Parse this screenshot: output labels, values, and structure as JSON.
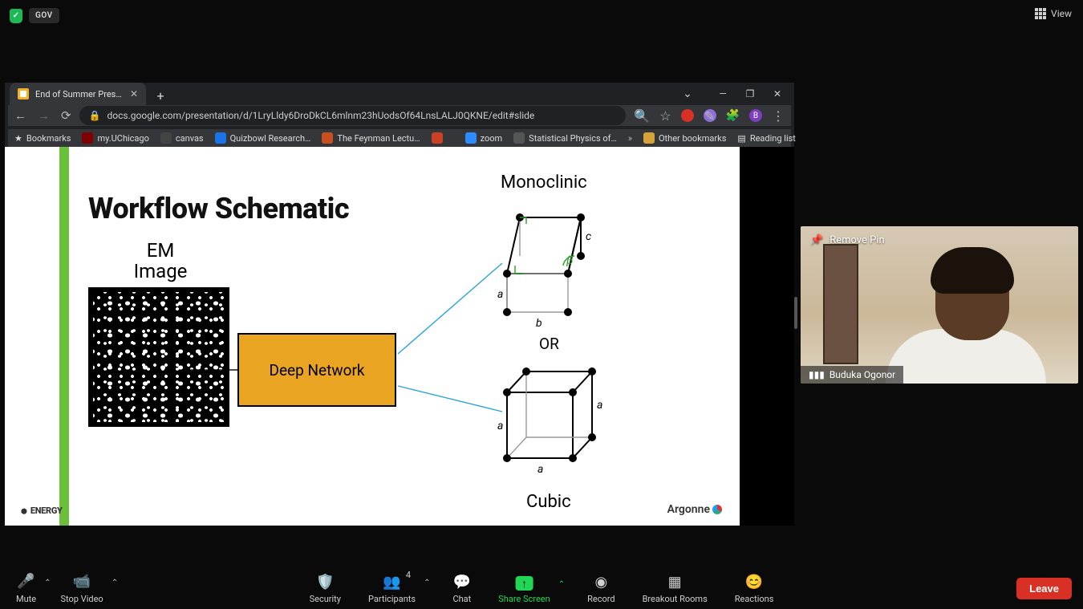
{
  "topbar": {
    "gov_label": "GOV",
    "view_label": "View"
  },
  "browser": {
    "tab_title": "End of Summer Presentation - G…",
    "url": "docs.google.com/presentation/d/1LryLldy6DroDkCL6mlnm23hUodsOf64LnsLALJ0QKNE/edit#slide",
    "profile_initial": "B",
    "bookmarks": {
      "b0": "Bookmarks",
      "b1": "my.UChicago",
      "b2": "canvas",
      "b3": "Quizbowl Research…",
      "b4": "The Feynman Lectu…",
      "b5": "zoom",
      "b6": "Statistical Physics of…",
      "other": "Other bookmarks",
      "reading": "Reading list"
    }
  },
  "slide": {
    "title": "Workflow Schematic",
    "em_label_l1": "EM",
    "em_label_l2": "Image",
    "deep_label": "Deep Network",
    "monoclinic": "Monoclinic",
    "or": "OR",
    "cubic": "Cubic",
    "energy_logo": "ENERGY",
    "argonne": "Argonne",
    "mono_params": {
      "a": "a",
      "b": "b",
      "c": "c",
      "beta": "β"
    },
    "cubic_params": {
      "a": "a"
    }
  },
  "speaker": {
    "remove_pin": "Remove Pin",
    "name": "Buduka Ogonor"
  },
  "toolbar": {
    "mute": "Mute",
    "stop_video": "Stop Video",
    "security": "Security",
    "participants": "Participants",
    "participants_count": "4",
    "chat": "Chat",
    "share": "Share Screen",
    "record": "Record",
    "breakout": "Breakout Rooms",
    "reactions": "Reactions",
    "leave": "Leave"
  }
}
